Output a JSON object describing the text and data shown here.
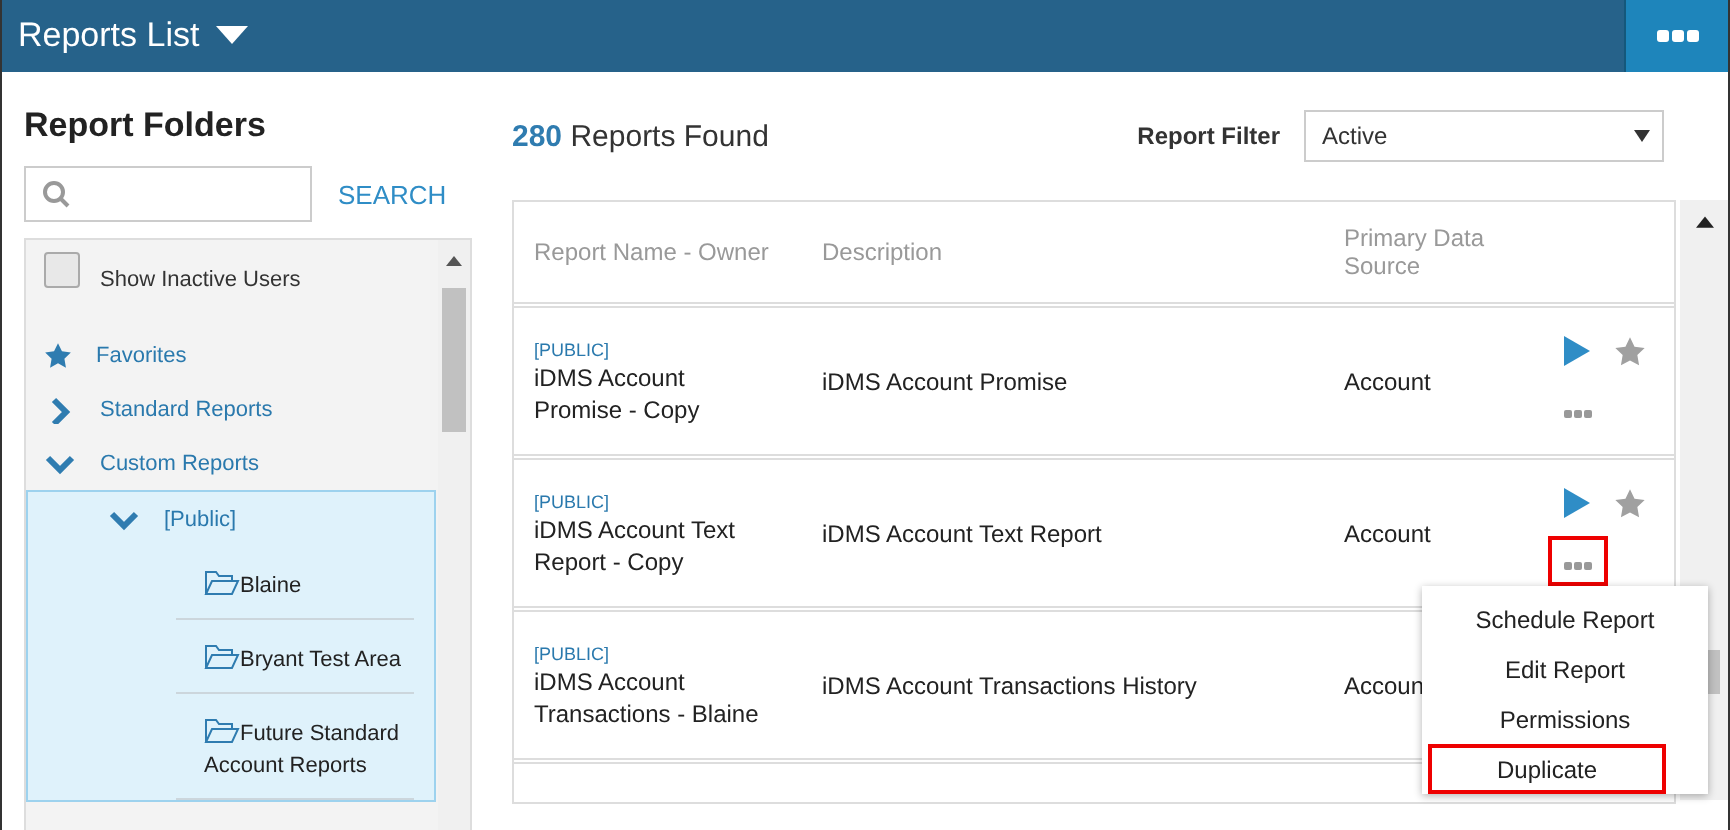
{
  "header": {
    "title": "Reports List"
  },
  "sidebar": {
    "title": "Report Folders",
    "search_button": "SEARCH",
    "show_inactive": {
      "label": "Show Inactive Users",
      "checked": false
    },
    "tree": [
      {
        "kind": "favorites",
        "label": "Favorites"
      },
      {
        "kind": "node",
        "label": "Standard Reports",
        "expanded": false
      },
      {
        "kind": "node",
        "label": "Custom Reports",
        "expanded": true,
        "children": [
          {
            "kind": "node",
            "label": "[Public]",
            "expanded": true,
            "selected": true,
            "children": [
              {
                "kind": "folder",
                "label": "Blaine"
              },
              {
                "kind": "folder",
                "label": "Bryant Test Area"
              },
              {
                "kind": "folder",
                "label": "Future Standard Account Reports"
              }
            ]
          }
        ]
      }
    ]
  },
  "summary": {
    "count": "280",
    "label": "Reports Found"
  },
  "filter": {
    "label": "Report Filter",
    "value": "Active"
  },
  "table": {
    "columns": [
      "Report Name - Owner",
      "Description",
      "Primary Data Source"
    ],
    "rows": [
      {
        "tag": "[PUBLIC]",
        "name": "iDMS Account Promise - Copy",
        "description": "iDMS Account Promise",
        "source": "Account",
        "favorite": false,
        "more_highlighted": false
      },
      {
        "tag": "[PUBLIC]",
        "name": "iDMS Account Text Report - Copy",
        "description": "iDMS Account Text Report",
        "source": "Account",
        "favorite": false,
        "more_highlighted": true
      },
      {
        "tag": "[PUBLIC]",
        "name": "iDMS Account Transactions - Blaine",
        "description": "iDMS Account Transactions History",
        "source": "Accoun"
      }
    ]
  },
  "menu": [
    {
      "label": "Schedule Report",
      "highlighted": false
    },
    {
      "label": "Edit Report",
      "highlighted": false
    },
    {
      "label": "Permissions",
      "highlighted": false
    },
    {
      "label": "Duplicate",
      "highlighted": true
    }
  ]
}
